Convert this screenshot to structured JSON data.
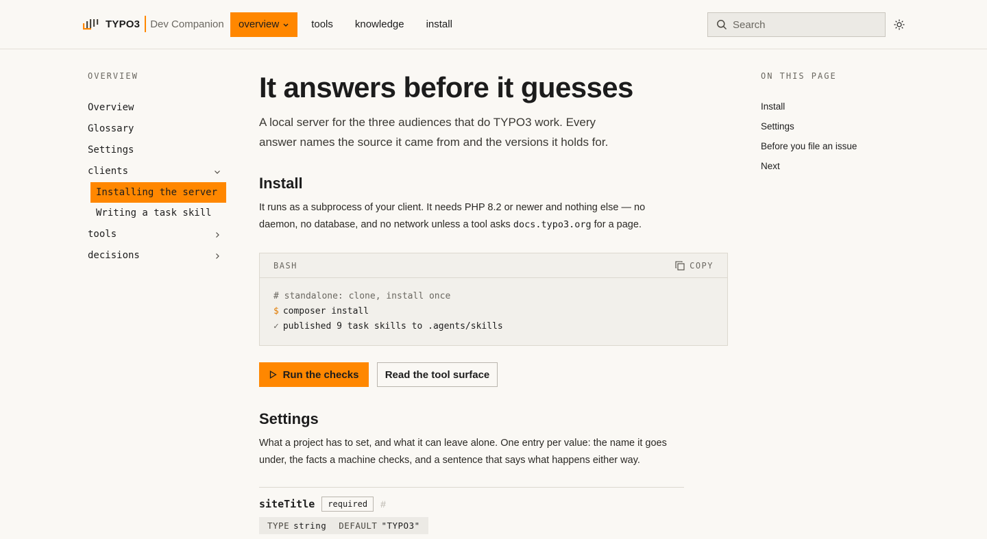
{
  "header": {
    "brand_name": "TYPO3",
    "brand_sub": "Dev Companion",
    "nav": [
      {
        "label": "overview"
      },
      {
        "label": "tools"
      },
      {
        "label": "knowledge"
      },
      {
        "label": "install"
      }
    ],
    "search_placeholder": "Search",
    "accent": "#ff8700"
  },
  "sidebar": {
    "heading": "OVERVIEW",
    "items": [
      {
        "label": "Overview"
      },
      {
        "label": "Glossary"
      },
      {
        "label": "Settings"
      },
      {
        "label": "clients"
      },
      {
        "label": "Installing the server"
      },
      {
        "label": "Writing a task skill"
      },
      {
        "label": "tools"
      },
      {
        "label": "decisions"
      }
    ]
  },
  "main": {
    "title": "It answers before it guesses",
    "lede": "A local server for the three audiences that do TYPO3 work. Every answer names the source it came from and the versions it holds for.",
    "install": {
      "title": "Install",
      "para_before": "It runs as a subprocess of your client. It needs PHP 8.2 or newer and nothing else — no daemon, no database, and no network unless a tool asks ",
      "para_code": "docs.typo3.org",
      "para_after": " for a page."
    },
    "codeblock": {
      "lang": "BASH",
      "copy_label": "COPY",
      "comment": "# standalone: clone, install once",
      "prompt": "$",
      "command": "composer install",
      "check": "✓",
      "output": "published 9 task skills to .agents/skills"
    },
    "buttons": {
      "primary": "Run the checks",
      "secondary": "Read the tool surface"
    },
    "settings": {
      "title": "Settings",
      "para": "What a project has to set, and what it can leave alone. One entry per value: the name it goes under, the facts a machine checks, and a sentence that says what happens either way.",
      "prop_name": "siteTitle",
      "prop_badge": "required",
      "prop_anchor": "#",
      "type_label": "TYPE",
      "type_value": "string",
      "default_label": "DEFAULT",
      "default_value": "\"TYPO3\""
    }
  },
  "toc": {
    "heading": "ON THIS PAGE",
    "items": [
      {
        "label": "Install"
      },
      {
        "label": "Settings"
      },
      {
        "label": "Before you file an issue"
      },
      {
        "label": "Next"
      }
    ]
  }
}
